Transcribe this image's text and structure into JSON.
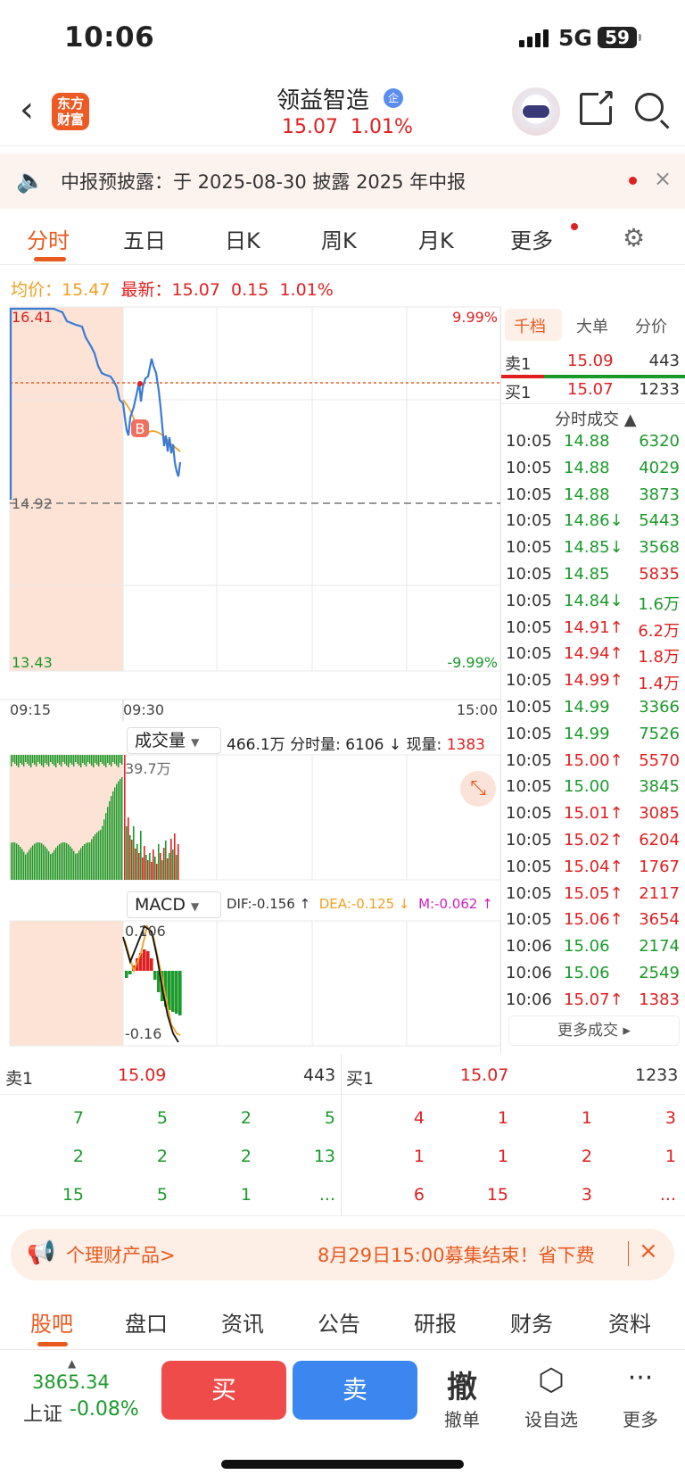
{
  "status": {
    "time": "10:06",
    "network": "5G",
    "battery": "59"
  },
  "header": {
    "name": "领益智造",
    "badge": "企",
    "price": "15.07",
    "change_pct": "1.01%",
    "logo": "东方\n财富"
  },
  "notice": {
    "text": "中报预披露：于 2025-08-30 披露 2025 年中报",
    "close": "×"
  },
  "tabs": [
    "分时",
    "五日",
    "日K",
    "周K",
    "月K",
    "更多"
  ],
  "stats": {
    "avg_label": "均价：",
    "avg": "15.47",
    "latest_label": "最新：",
    "latest": "15.07",
    "change": "0.15",
    "change_pct": "1.01%"
  },
  "chart_axis": {
    "top_price": "16.41",
    "top_pct": "9.99%",
    "mid_price": "14.92",
    "bot_price": "13.43",
    "bot_pct": "-9.99%",
    "t0": "09:15",
    "t1": "09:30",
    "t2": "15:00",
    "marker": "B"
  },
  "colors": {
    "up": "#e02020",
    "down": "#1a9a2a",
    "accent": "#e85a1e",
    "line": "#3a7bd5",
    "avg": "#f0a020"
  },
  "orderbook_side": {
    "tabs": [
      "千档",
      "大单",
      "分价"
    ],
    "ask_label": "卖1",
    "ask_price": "15.09",
    "ask_vol": "443",
    "bid_label": "买1",
    "bid_price": "15.07",
    "bid_vol": "1233",
    "trades_title": "分时成交 ▲"
  },
  "trades": [
    {
      "t": "10:05",
      "p": "14.88",
      "a": "",
      "v": "6320",
      "c": "down"
    },
    {
      "t": "10:05",
      "p": "14.88",
      "a": "",
      "v": "4029",
      "c": "down"
    },
    {
      "t": "10:05",
      "p": "14.88",
      "a": "",
      "v": "3873",
      "c": "down"
    },
    {
      "t": "10:05",
      "p": "14.86",
      "a": "↓",
      "v": "5443",
      "c": "down"
    },
    {
      "t": "10:05",
      "p": "14.85",
      "a": "↓",
      "v": "3568",
      "c": "down"
    },
    {
      "t": "10:05",
      "p": "14.85",
      "a": "",
      "v": "5835",
      "c": "up"
    },
    {
      "t": "10:05",
      "p": "14.84",
      "a": "↓",
      "v": "1.6万",
      "c": "down"
    },
    {
      "t": "10:05",
      "p": "14.91",
      "a": "↑",
      "v": "6.2万",
      "c": "up"
    },
    {
      "t": "10:05",
      "p": "14.94",
      "a": "↑",
      "v": "1.8万",
      "c": "up"
    },
    {
      "t": "10:05",
      "p": "14.99",
      "a": "↑",
      "v": "1.4万",
      "c": "up"
    },
    {
      "t": "10:05",
      "p": "14.99",
      "a": "",
      "v": "3366",
      "c": "down"
    },
    {
      "t": "10:05",
      "p": "14.99",
      "a": "",
      "v": "7526",
      "c": "down"
    },
    {
      "t": "10:05",
      "p": "15.00",
      "a": "↑",
      "v": "5570",
      "c": "up"
    },
    {
      "t": "10:05",
      "p": "15.00",
      "a": "",
      "v": "3845",
      "c": "down"
    },
    {
      "t": "10:05",
      "p": "15.01",
      "a": "↑",
      "v": "3085",
      "c": "up"
    },
    {
      "t": "10:05",
      "p": "15.02",
      "a": "↑",
      "v": "6204",
      "c": "up"
    },
    {
      "t": "10:05",
      "p": "15.04",
      "a": "↑",
      "v": "1767",
      "c": "up"
    },
    {
      "t": "10:05",
      "p": "15.05",
      "a": "↑",
      "v": "2117",
      "c": "up"
    },
    {
      "t": "10:05",
      "p": "15.06",
      "a": "↑",
      "v": "3654",
      "c": "up"
    },
    {
      "t": "10:06",
      "p": "15.06",
      "a": "",
      "v": "2174",
      "c": "down"
    },
    {
      "t": "10:06",
      "p": "15.06",
      "a": "",
      "v": "2549",
      "c": "down"
    },
    {
      "t": "10:06",
      "p": "15.07",
      "a": "↑",
      "v": "1383",
      "c": "up"
    }
  ],
  "more_trades": "更多成交 ▸",
  "volume": {
    "label": "成交量",
    "info_total": "466.1万",
    "info_minute_label": "分时量:",
    "info_minute": "6106 ↓",
    "info_now_label": "现量:",
    "info_now": "1383",
    "axis_max": "39.7万"
  },
  "macd": {
    "label": "MACD",
    "dif": "DIF:-0.156 ↑",
    "dea": "DEA:-0.125 ↓",
    "m": "M:-0.062 ↑",
    "top": "0.106",
    "bot": "-0.16"
  },
  "orderbook": {
    "ask_label": "卖1",
    "ask_price": "15.09",
    "ask_vol": "443",
    "bid_label": "买1",
    "bid_price": "15.07",
    "bid_vol": "1233",
    "ask_rows": [
      [
        "7",
        "5",
        "2",
        "5"
      ],
      [
        "2",
        "2",
        "2",
        "13"
      ],
      [
        "15",
        "5",
        "1",
        "..."
      ]
    ],
    "bid_rows": [
      [
        "4",
        "1",
        "1",
        "3"
      ],
      [
        "1",
        "1",
        "2",
        "1"
      ],
      [
        "6",
        "15",
        "3",
        "..."
      ]
    ]
  },
  "ad": {
    "left": "个理财产品>",
    "right": "8月29日15:00募集结束！省下费",
    "close": "×"
  },
  "bottom_tabs": [
    "股吧",
    "盘口",
    "资讯",
    "公告",
    "研报",
    "财务",
    "资料"
  ],
  "bottom_bar": {
    "index_value": "3865.34",
    "index_name": "上证",
    "index_change": "-0.08%",
    "buy": "买",
    "sell": "卖",
    "cancel_icon": "撤",
    "cancel": "撤单",
    "watch": "设自选",
    "more": "更多"
  }
}
